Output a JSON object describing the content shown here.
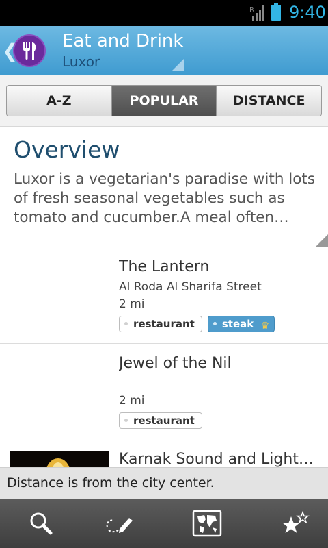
{
  "status_bar": {
    "time": "9:40",
    "roaming": "R"
  },
  "action_bar": {
    "title": "Eat and Drink",
    "subtitle": "Luxor",
    "back_glyph": "❮"
  },
  "tabs": [
    {
      "label": "A-Z",
      "active": false
    },
    {
      "label": "POPULAR",
      "active": true
    },
    {
      "label": "DISTANCE",
      "active": false
    }
  ],
  "overview": {
    "title": "Overview",
    "text": "Luxor is a vegetarian's paradise with lots of fresh seasonal vegetables such as tomato and cucumber.A meal often…"
  },
  "list": [
    {
      "name": "The Lantern",
      "address": "Al Roda Al Sharifa Street",
      "distance": "2 mi",
      "tags": [
        {
          "label": "restaurant",
          "premium": false
        },
        {
          "label": "steak",
          "premium": true
        }
      ]
    },
    {
      "name": "Jewel of the Nil",
      "address": "",
      "distance": "2 mi",
      "tags": [
        {
          "label": "restaurant",
          "premium": false
        }
      ]
    },
    {
      "name": "Karnak Sound and Light…",
      "address": "",
      "distance": "",
      "tags": []
    }
  ],
  "toast": {
    "text": "Distance is from the city center."
  },
  "bottom_bar": [
    {
      "icon": "search-icon"
    },
    {
      "icon": "edit-route-icon"
    },
    {
      "icon": "map-icon"
    },
    {
      "icon": "favorites-stars-icon"
    }
  ],
  "colors": {
    "accent": "#33b5e5",
    "header": "#4fa8d8",
    "title": "#1f4e6e",
    "premium_tag": "#4f9ccc"
  }
}
